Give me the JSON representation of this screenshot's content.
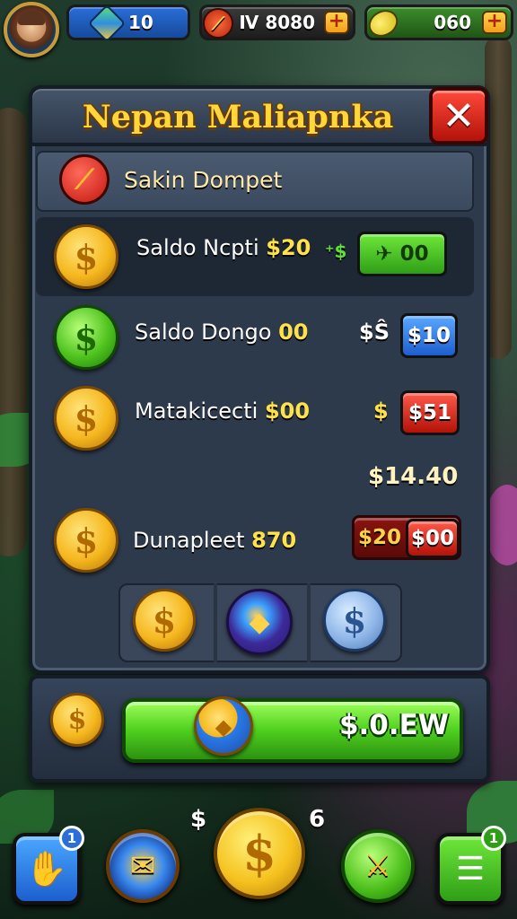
{
  "topbar": {
    "gems_value": "10",
    "cash_value": "Ⅳ 8080",
    "leaf_value": "060",
    "plus_glyph": "+"
  },
  "dialog": {
    "title": "Nepan Maliapnka",
    "close_glyph": "✕",
    "subheader_label": "Sakin Dompet"
  },
  "rows": [
    {
      "label": "Saldo Ncpti",
      "amount": "$20",
      "symbol": "⁺$",
      "action_label": "✈ 00",
      "action_color": "green",
      "coin": "gold"
    },
    {
      "label": "Saldo Dongo",
      "amount": "00",
      "symbol": "$Ŝ",
      "action_label": "$10",
      "action_color": "blue",
      "coin": "green"
    },
    {
      "label": "Matakicecti",
      "amount": "$00",
      "symbol": "$",
      "action_label": "$51",
      "action_color": "red",
      "coin": "gold"
    },
    {
      "label": "Dunapleet",
      "amount": "870",
      "symbol": "",
      "action_secondary_label": "$20",
      "action_label": "$00",
      "action_color": "red",
      "coin": "gold"
    }
  ],
  "subtotal": "$14.40",
  "coin_glyph": "$",
  "tray": {
    "items": [
      {
        "name": "gold-coin",
        "glyph": "$"
      },
      {
        "name": "gem-coin",
        "glyph": "◆"
      },
      {
        "name": "silver-coin",
        "glyph": "$"
      }
    ]
  },
  "footer": {
    "buy_label": "$.0.EW"
  },
  "bottom_nav": {
    "left_label": "$",
    "right_label": "6",
    "badge_left": "1",
    "badge_right": "1"
  },
  "colors": {
    "title_gold": "#ffd73a",
    "close_red": "#e0281a",
    "action_green": "#4fcf1e",
    "action_blue": "#2a7ae8",
    "action_red": "#d41e10",
    "panel_bg": "#2d3a4b"
  }
}
